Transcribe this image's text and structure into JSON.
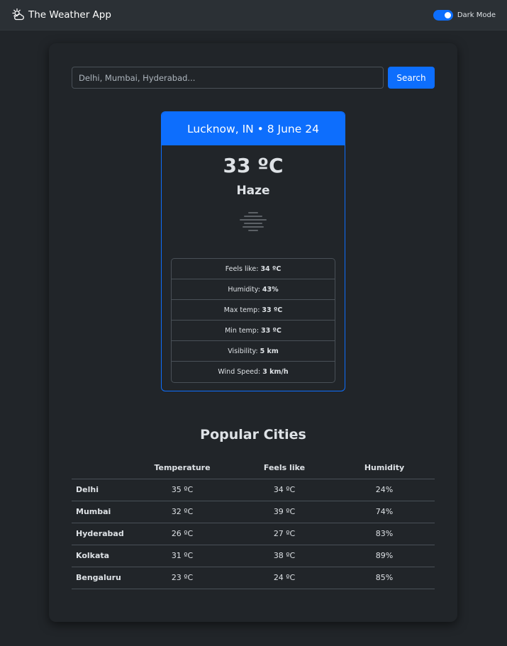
{
  "navbar": {
    "brand_icon": "sun-cloud-icon",
    "title": "The Weather App",
    "toggle_label": "Dark Mode",
    "toggle_on": true
  },
  "search": {
    "placeholder": "Delhi, Mumbai, Hyderabad...",
    "value": "",
    "button_label": "Search"
  },
  "weather_card": {
    "header": "Lucknow, IN • 8 June 24",
    "temperature": "33 ºC",
    "condition": "Haze",
    "condition_icon": "haze-icon",
    "details": [
      {
        "label": "Feels like:",
        "value": "34 ºC"
      },
      {
        "label": "Humidity:",
        "value": "43%"
      },
      {
        "label": "Max temp:",
        "value": "33 ºC"
      },
      {
        "label": "Min temp:",
        "value": "33 ºC"
      },
      {
        "label": "Visibility:",
        "value": "5 km"
      },
      {
        "label": "Wind Speed:",
        "value": "3 km/h"
      }
    ]
  },
  "popular": {
    "title": "Popular Cities",
    "headers": [
      "",
      "Temperature",
      "Feels like",
      "Humidity"
    ],
    "rows": [
      {
        "city": "Delhi",
        "temperature": "35 ºC",
        "feels_like": "34 ºC",
        "humidity": "24%"
      },
      {
        "city": "Mumbai",
        "temperature": "32 ºC",
        "feels_like": "39 ºC",
        "humidity": "74%"
      },
      {
        "city": "Hyderabad",
        "temperature": "26 ºC",
        "feels_like": "27 ºC",
        "humidity": "83%"
      },
      {
        "city": "Kolkata",
        "temperature": "31 ºC",
        "feels_like": "38 ºC",
        "humidity": "89%"
      },
      {
        "city": "Bengaluru",
        "temperature": "23 ºC",
        "feels_like": "24 ºC",
        "humidity": "85%"
      }
    ]
  },
  "colors": {
    "background": "#212529",
    "navbar": "#2b3035",
    "accent": "#0d6efd",
    "border": "#495057",
    "text": "#dee2e6"
  }
}
